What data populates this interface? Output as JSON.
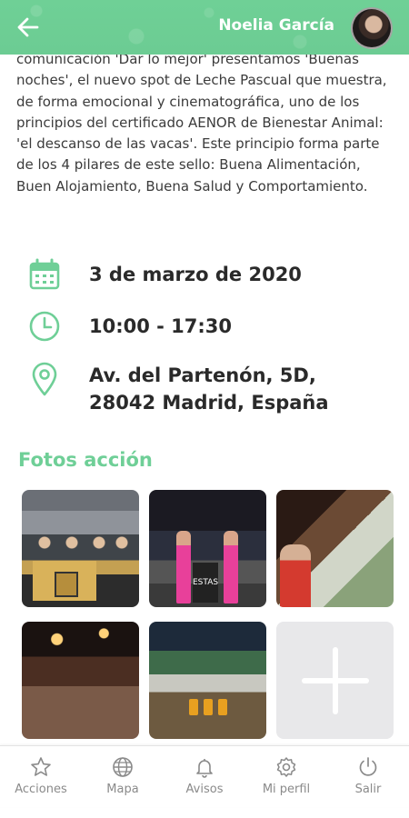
{
  "header": {
    "user_name": "Noelia García"
  },
  "event": {
    "description": "comunicación 'Dar lo mejor' presentamos 'Buenas noches', el nuevo spot de Leche Pascual que muestra, de forma emocional y cinematográfica, uno de los principios del certificado AENOR de Bienestar Animal: 'el descanso de las vacas'. Este principio forma parte de los 4 pilares de este sello: Buena Alimentación, Buen Alojamiento, Buena Salud y Comportamiento.",
    "date": "3 de marzo de 2020",
    "time": "10:00 - 17:30",
    "address_line1": "Av. del Partenón, 5D,",
    "address_line2": "28042 Madrid, España"
  },
  "photos_section": {
    "title": "Fotos acción",
    "sign_text": "ESTAS"
  },
  "nav": {
    "items": [
      {
        "label": "Acciones",
        "icon": "star-icon"
      },
      {
        "label": "Mapa",
        "icon": "globe-icon"
      },
      {
        "label": "Avisos",
        "icon": "bell-icon"
      },
      {
        "label": "Mi perfil",
        "icon": "gear-icon"
      },
      {
        "label": "Salir",
        "icon": "power-icon"
      }
    ]
  },
  "colors": {
    "accent": "#6fcf97",
    "text": "#2a2a2a",
    "nav_text": "#8a8a8a"
  }
}
